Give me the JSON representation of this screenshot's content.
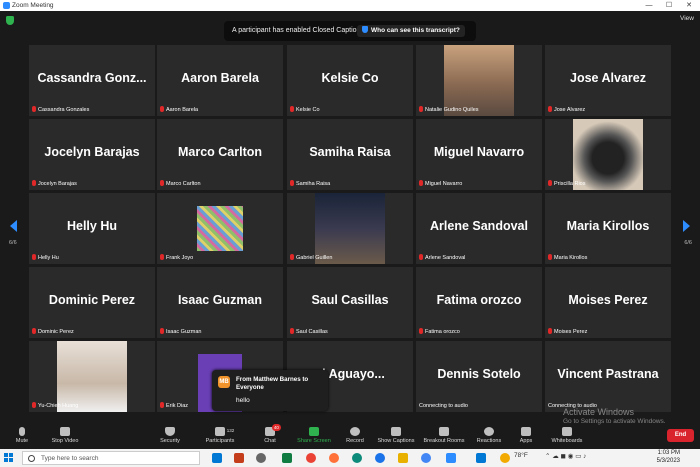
{
  "window": {
    "title": "Zoom Meeting",
    "controls": [
      "—",
      "☐",
      "✕"
    ]
  },
  "view_label": "View",
  "banner": {
    "message": "A participant has enabled Closed Captioning",
    "button": "Who can see this transcript?"
  },
  "tiles": [
    {
      "display": "Cassandra  Gonz...",
      "label": "Cassandra Gonzales"
    },
    {
      "display": "Aaron Barela",
      "label": "Aaron Barela"
    },
    {
      "display": "Kelsie Co",
      "label": "Kelsie Co"
    },
    {
      "display": "",
      "label": "Natalie Gudino Quiles",
      "video": "person-sitting-video"
    },
    {
      "display": "Jose Alvarez",
      "label": "Jose Alvarez"
    },
    {
      "display": "Jocelyn Barajas",
      "label": "Jocelyn Barajas"
    },
    {
      "display": "Marco Carlton",
      "label": "Marco Carlton"
    },
    {
      "display": "Samiha Raisa",
      "label": "Samiha Raisa"
    },
    {
      "display": "Miguel Navarro",
      "label": "Miguel Navarro"
    },
    {
      "display": "",
      "label": "Priscilla Rios",
      "video": "dog-video"
    },
    {
      "display": "Helly Hu",
      "label": "Helly Hu"
    },
    {
      "display": "",
      "label": "Frank Joyo",
      "video": "pixel-image"
    },
    {
      "display": "",
      "label": "Gabriel Guillen",
      "video": "street-night-video"
    },
    {
      "display": "Arlene Sandoval",
      "label": "Arlene Sandoval"
    },
    {
      "display": "Maria Kirollos",
      "label": "Maria Kirollos"
    },
    {
      "display": "Dominic Perez",
      "label": "Dominic Perez"
    },
    {
      "display": "Isaac Guzman",
      "label": "Isaac Guzman"
    },
    {
      "display": "Saul Casillas",
      "label": "Saul Casillas"
    },
    {
      "display": "Fatima orozco",
      "label": "Fatima orozco"
    },
    {
      "display": "Moises Perez",
      "label": "Moises Perez"
    },
    {
      "display": "",
      "label": "Yu-Chieh Huang",
      "video": "person-photo"
    },
    {
      "display": "",
      "label": "Erik Diaz",
      "video": "purple-image"
    },
    {
      "display": "el  Aguayo...",
      "label": "ayo-Vargas"
    },
    {
      "display": "Dennis Sotelo",
      "label": "Connecting to audio"
    },
    {
      "display": "Vincent Pastrana",
      "label": "Connecting to audio"
    }
  ],
  "pager": {
    "left": "6/6",
    "right": "6/6"
  },
  "chat_popup": {
    "avatar": "MB",
    "from": "From Matthew Barnes to Everyone",
    "message": "hello"
  },
  "toolbar": {
    "mute": "Mute",
    "stop_video": "Stop Video",
    "security": "Security",
    "participants": "Participants",
    "participants_count": "132",
    "chat": "Chat",
    "chat_badge": "40",
    "share_screen": "Share Screen",
    "record": "Record",
    "show_captions": "Show Captions",
    "breakout_rooms": "Breakout Rooms",
    "reactions": "Reactions",
    "apps": "Apps",
    "whiteboards": "Whiteboards",
    "end": "End"
  },
  "activate_windows": {
    "title": "Activate Windows",
    "subtitle": "Go to Settings to activate Windows."
  },
  "taskbar": {
    "search_placeholder": "Type here to search",
    "weather": "78°F",
    "time": "1:03 PM",
    "date": "5/3/2023"
  }
}
